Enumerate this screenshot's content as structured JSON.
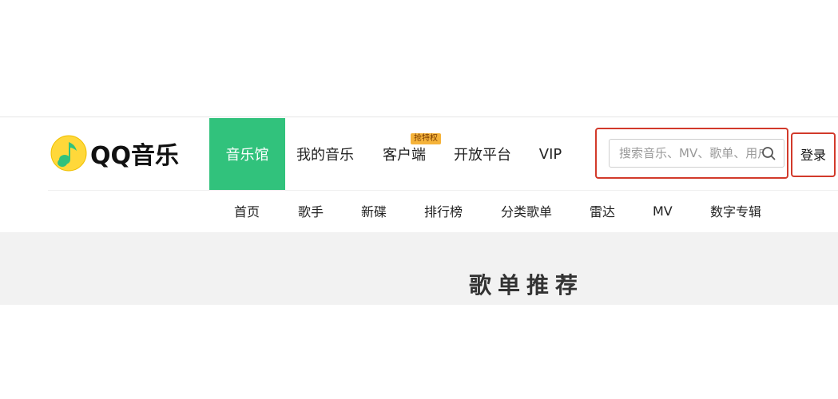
{
  "brand": {
    "name": "QQ音乐"
  },
  "nav": {
    "items": [
      {
        "label": "音乐馆",
        "active": true
      },
      {
        "label": "我的音乐"
      },
      {
        "label": "客户端",
        "badge": "抢特权"
      },
      {
        "label": "开放平台"
      },
      {
        "label": "VIP"
      }
    ]
  },
  "search": {
    "placeholder": "搜索音乐、MV、歌单、用户"
  },
  "login": {
    "label": "登录"
  },
  "subnav": {
    "items": [
      "首页",
      "歌手",
      "新碟",
      "排行榜",
      "分类歌单",
      "雷达",
      "MV",
      "数字专辑"
    ]
  },
  "section": {
    "title": "歌单推荐"
  },
  "colors": {
    "accent": "#31c27c",
    "highlight": "#d23a2b",
    "badge": "#f5b33a",
    "band": "#f2f2f2"
  },
  "icons": {
    "logo": "qq-music-note-logo",
    "search": "search-icon"
  }
}
